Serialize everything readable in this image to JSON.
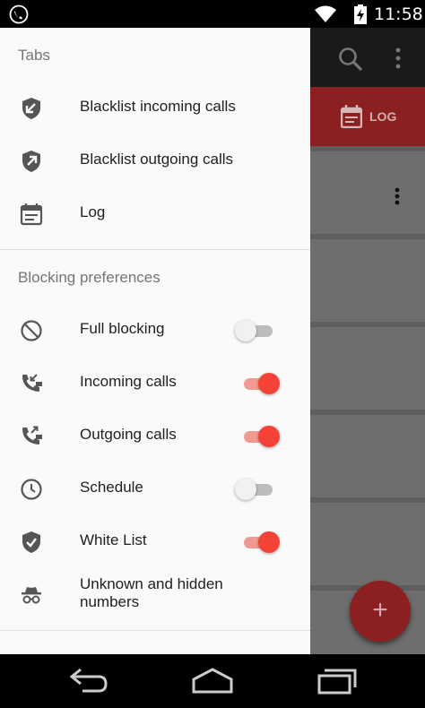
{
  "status_bar": {
    "time": "11:58",
    "icons": [
      "app-phone-icon",
      "wifi-icon",
      "battery-charging-icon"
    ]
  },
  "app": {
    "toolbar_icons": [
      "search-icon",
      "more-vertical-icon"
    ],
    "active_tab": {
      "label": "LOG",
      "icon": "calendar-icon"
    },
    "fab_icon": "plus-icon",
    "colors": {
      "primary": "#c62828",
      "accent": "#f44336"
    }
  },
  "drawer": {
    "tabs_header": "Tabs",
    "tabs": [
      {
        "label": "Blacklist incoming calls",
        "icon": "shield-incoming-icon"
      },
      {
        "label": "Blacklist outgoing calls",
        "icon": "shield-outgoing-icon"
      },
      {
        "label": "Log",
        "icon": "calendar-icon"
      }
    ],
    "prefs_header": "Blocking preferences",
    "prefs": [
      {
        "label": "Full blocking",
        "icon": "block-icon",
        "enabled": false
      },
      {
        "label": "Incoming calls",
        "icon": "phone-incoming-lock-icon",
        "enabled": true
      },
      {
        "label": "Outgoing calls",
        "icon": "phone-outgoing-lock-icon",
        "enabled": true
      },
      {
        "label": "Schedule",
        "icon": "clock-icon",
        "enabled": false
      },
      {
        "label": "White List",
        "icon": "shield-check-icon",
        "enabled": true
      },
      {
        "label": "Unknown and hidden numbers",
        "icon": "incognito-icon"
      }
    ]
  },
  "nav_bar": [
    "back-icon",
    "home-icon",
    "recents-icon"
  ]
}
